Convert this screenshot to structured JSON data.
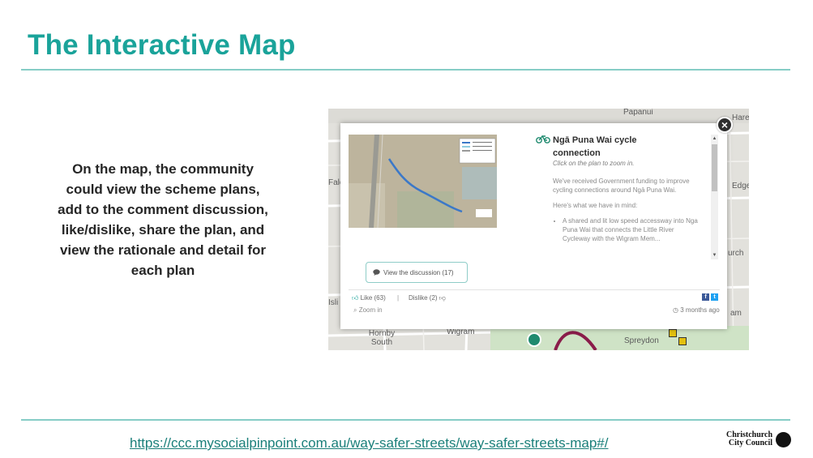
{
  "slide": {
    "title": "The Interactive Map",
    "description": "On the map, the community could view the scheme plans, add to the comment discussion, like/dislike, share the plan, and view the rationale and detail for each plan",
    "url": "https://ccc.mysocialpinpoint.com.au/way-safer-streets/way-safer-streets-map#/"
  },
  "logo": {
    "line1": "Christchurch",
    "line2": "City Council"
  },
  "map": {
    "labels": {
      "papanui": "Papanui",
      "edge": "Edge",
      "urch": "urch",
      "am": "am",
      "falc": "Falc",
      "isli": "Isli",
      "hornby_south": "Hornby South",
      "wigram": "Wigram",
      "spreydon": "Spreydon",
      "hare": "Hare"
    }
  },
  "popup": {
    "title": "Ngā Puna Wai cycle connection",
    "subtitle": "Click on the plan to zoom in.",
    "paragraph1": "We've received Government funding to improve cycling connections around Ngā Puna Wai.",
    "paragraph2": "Here's what we have in mind:",
    "bullet1": "A shared and lit low speed accessway into Nga Puna Wai that connects the Little River Cycleway with the Wigram Mem...",
    "discussion_label": "View the discussion (17)",
    "like_label": "Like (63)",
    "separator": "|",
    "dislike_label": "Dislike (2)",
    "zoom_label": "Zoom in",
    "timestamp": "3 months ago",
    "close_symbol": "×"
  },
  "icons": {
    "bike": "bike-icon",
    "close": "close-icon",
    "comment": "comment-icon",
    "thumbs_up": "thumbs-up-icon",
    "thumbs_down": "thumbs-down-icon",
    "search": "search-icon",
    "clock": "clock-icon",
    "facebook": "facebook-icon",
    "twitter": "twitter-icon"
  },
  "colors": {
    "accent": "#1aa39a",
    "rule": "#86cdc6",
    "link": "#1a7f7a"
  }
}
